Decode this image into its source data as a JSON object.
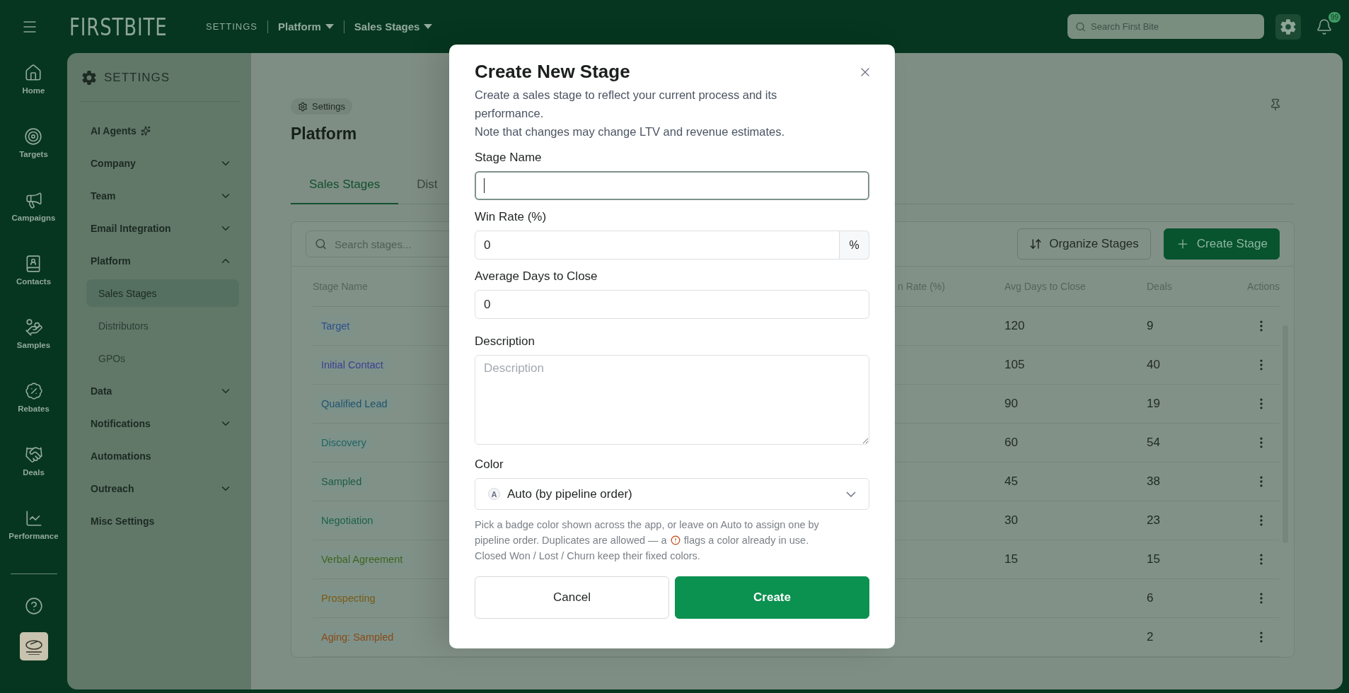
{
  "topbar": {
    "brand": "FIRST**BITE**",
    "breadcrumbs": [
      {
        "label": "SETTINGS",
        "kind": "plain"
      },
      {
        "label": "Platform",
        "kind": "dropdown"
      },
      {
        "label": "Sales Stages",
        "kind": "dropdown"
      }
    ],
    "search": {
      "placeholder": "Search First Bite"
    },
    "notification_count": "99"
  },
  "rail": {
    "items": [
      {
        "label": "Home"
      },
      {
        "label": "Targets"
      },
      {
        "label": "Campaigns"
      },
      {
        "label": "Contacts"
      },
      {
        "label": "Samples"
      },
      {
        "label": "Rebates"
      },
      {
        "label": "Deals"
      },
      {
        "label": "Performance"
      }
    ]
  },
  "settings_nav": {
    "title": "SETTINGS",
    "items": [
      {
        "label": "AI Agents",
        "kind": "sparkle",
        "selected": false
      },
      {
        "label": "Company",
        "kind": "group",
        "expanded": false,
        "selected": false
      },
      {
        "label": "Team",
        "kind": "group",
        "expanded": false,
        "selected": false
      },
      {
        "label": "Email Integration",
        "kind": "group",
        "expanded": false,
        "selected": false
      },
      {
        "label": "Platform",
        "kind": "group",
        "expanded": true,
        "selected": false,
        "children": [
          {
            "label": "Sales Stages",
            "selected": true
          },
          {
            "label": "Distributors",
            "selected": false
          },
          {
            "label": "GPOs",
            "selected": false
          }
        ]
      },
      {
        "label": "Data",
        "kind": "group",
        "expanded": false,
        "selected": false
      },
      {
        "label": "Notifications",
        "kind": "group",
        "expanded": false,
        "selected": false
      },
      {
        "label": "Automations",
        "kind": "link",
        "selected": false
      },
      {
        "label": "Outreach",
        "kind": "group",
        "expanded": false,
        "selected": false
      },
      {
        "label": "Misc Settings",
        "kind": "link",
        "selected": false
      }
    ]
  },
  "content": {
    "chip": "Settings",
    "title": "Platform",
    "tabs": [
      {
        "label": "Sales Stages",
        "selected": true
      },
      {
        "label": "Dist",
        "selected": false
      }
    ],
    "table": {
      "search": {
        "placeholder": "Search stages..."
      },
      "buttons": [
        {
          "label": "Organize Stages",
          "kind": "secondary"
        },
        {
          "label": "Create Stage",
          "kind": "primary"
        }
      ],
      "columns": [
        "Stage Name",
        "n Rate (%)",
        "Avg Days to Close",
        "Deals",
        "Actions"
      ],
      "rows": [
        {
          "stage": "Target",
          "color": "#2e4f8e",
          "avg_days": "120",
          "deals": "9"
        },
        {
          "stage": "Initial Contact",
          "color": "#3a3f93",
          "avg_days": "105",
          "deals": "40"
        },
        {
          "stage": "Qualified Lead",
          "color": "#1f5470",
          "avg_days": "90",
          "deals": "19"
        },
        {
          "stage": "Discovery",
          "color": "#1e6466",
          "avg_days": "60",
          "deals": "54"
        },
        {
          "stage": "Sampled",
          "color": "#1e5a48",
          "avg_days": "45",
          "deals": "38"
        },
        {
          "stage": "Negotiation",
          "color": "#1d6245",
          "avg_days": "30",
          "deals": "23"
        },
        {
          "stage": "Verbal Agreement",
          "color": "#3d6420",
          "avg_days": "15",
          "deals": "15"
        },
        {
          "stage": "Prospecting",
          "color": "#7a5a16",
          "deals": "6"
        },
        {
          "stage": "Aging: Sampled",
          "color": "#8a4a18",
          "deals": "2"
        }
      ]
    }
  },
  "modal": {
    "title": "Create New Stage",
    "description": [
      "Create a sales stage to reflect your current process and its performance.",
      "Note that changes may change LTV and revenue estimates."
    ],
    "fields": [
      {
        "kind": "text",
        "label": "Stage Name",
        "focused": true
      },
      {
        "kind": "suffix",
        "label": "Win Rate (%)",
        "value": "0",
        "suffix": "%",
        "focused": false
      },
      {
        "kind": "text",
        "label": "Average Days to Close",
        "value": "0",
        "focused": false
      },
      {
        "kind": "textarea",
        "label": "Description",
        "placeholder": "Description"
      },
      {
        "kind": "select",
        "label": "Color",
        "badge": "A",
        "value": "Auto (by pipeline order)",
        "help": [
          {
            "text": "Pick a badge color shown across the app, or leave on Auto to assign one by"
          },
          {
            "text": "pipeline order. Duplicates are allowed — a",
            "tail": "flags a color already in use."
          },
          {
            "text": "Closed Won / Lost / Churn keep their fixed colors."
          }
        ]
      }
    ],
    "buttons": [
      {
        "label": "Cancel",
        "kind": "secondary"
      },
      {
        "label": "Create",
        "kind": "primary"
      }
    ]
  }
}
